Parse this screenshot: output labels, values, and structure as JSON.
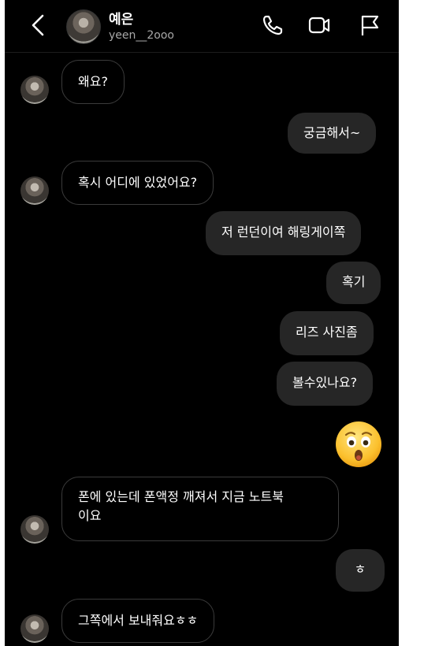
{
  "header": {
    "name": "예은",
    "username": "yeen__2ooo",
    "icons": [
      "back-chevron-icon",
      "phone-icon",
      "video-camera-icon",
      "flag-icon"
    ]
  },
  "messages": [
    {
      "from": "them",
      "text": "왜요?"
    },
    {
      "from": "me",
      "text": "궁금해서~"
    },
    {
      "from": "them",
      "text": "혹시 어디에 있었어요?"
    },
    {
      "from": "me",
      "text": "저 런던이여 해링게이쪽"
    },
    {
      "from": "me",
      "text": "혹기"
    },
    {
      "from": "me",
      "text": "리즈 사진좀"
    },
    {
      "from": "me",
      "text": "볼수있나요?"
    },
    {
      "from": "me",
      "emoji": "hushed-face-emoji"
    },
    {
      "from": "them",
      "text": "폰에 있는데 폰액정 깨져서 지금 노트북\n이요"
    },
    {
      "from": "me",
      "text": "ㅎ"
    },
    {
      "from": "them",
      "text": "그쪽에서 보내줘요ㅎㅎ"
    }
  ],
  "colors": {
    "background": "#000000",
    "outgoing_bubble": "#262626",
    "incoming_border": "#3b3b3b",
    "text": "#ffffff",
    "username": "#a8a8a8"
  }
}
